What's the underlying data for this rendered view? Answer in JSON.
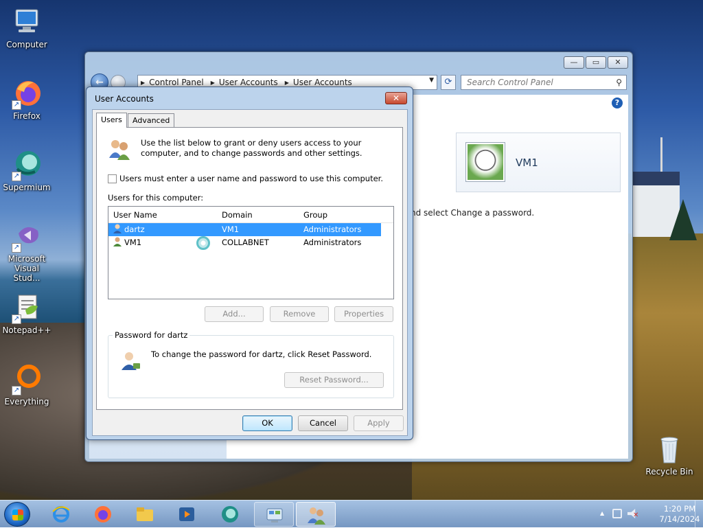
{
  "desktop": {
    "icons": [
      {
        "label": "Computer"
      },
      {
        "label": "Firefox"
      },
      {
        "label": "Supermium"
      },
      {
        "label": "Microsoft Visual Stud..."
      },
      {
        "label": "Notepad++"
      },
      {
        "label": "Everything"
      },
      {
        "label": "Recycle Bin"
      }
    ]
  },
  "control_panel": {
    "address": {
      "crumbs": [
        "Control Panel",
        "User Accounts",
        "User Accounts"
      ]
    },
    "search_placeholder": "Search Control Panel",
    "user_name": "VM1",
    "description_fragment": "nd select Change a password."
  },
  "dialog": {
    "title": "User Accounts",
    "tabs": [
      "Users",
      "Advanced"
    ],
    "intro": "Use the list below to grant or deny users access to your computer, and to change passwords and other settings.",
    "checkbox_label": "Users must enter a user name and password to use this computer.",
    "checkbox_checked": false,
    "list_caption": "Users for this computer:",
    "columns": [
      "User Name",
      "Domain",
      "Group"
    ],
    "rows": [
      {
        "name": "dartz",
        "domain": "VM1",
        "group": "Administrators",
        "selected": true
      },
      {
        "name": "VM1",
        "domain": "COLLABNET",
        "group": "Administrators",
        "selected": false
      }
    ],
    "buttons": {
      "add": "Add...",
      "remove": "Remove",
      "properties": "Properties"
    },
    "password_group": {
      "legend": "Password for dartz",
      "text": "To change the password for dartz, click Reset Password.",
      "reset_button": "Reset Password..."
    },
    "footer": {
      "ok": "OK",
      "cancel": "Cancel",
      "apply": "Apply"
    }
  },
  "taskbar": {
    "clock": {
      "time": "1:20 PM",
      "date": "7/14/2024"
    }
  }
}
